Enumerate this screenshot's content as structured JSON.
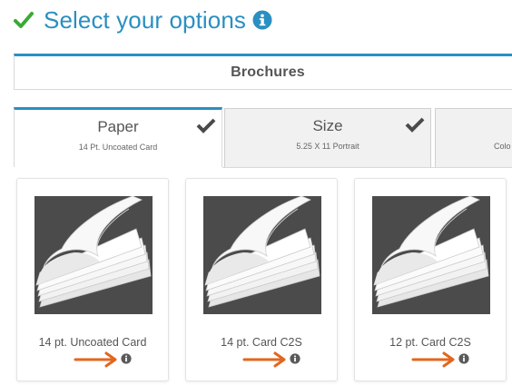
{
  "header": {
    "title": "Select your options",
    "check_icon": "check-icon",
    "info_icon": "info-circle-icon",
    "accent_color": "#2a8fc1",
    "check_color": "#3aaa35"
  },
  "product": {
    "label": "Brochures"
  },
  "tabs": [
    {
      "label": "Paper",
      "sub": "14 Pt. Uncoated Card",
      "active": true,
      "completed": true
    },
    {
      "label": "Size",
      "sub": "5.25 X 11 Portrait",
      "active": false,
      "completed": true
    },
    {
      "label": "",
      "sub": "Colo",
      "active": false,
      "completed": false
    }
  ],
  "options": [
    {
      "name": "14 pt. Uncoated Card",
      "info_icon": "info-circle-icon",
      "annotation": "orange-arrow"
    },
    {
      "name": "14 pt. Card C2S",
      "info_icon": "info-circle-icon",
      "annotation": "orange-arrow"
    },
    {
      "name": "12 pt. Card C2S",
      "info_icon": "info-circle-icon",
      "annotation": "orange-arrow"
    }
  ],
  "annotation_color": "#e2661d"
}
